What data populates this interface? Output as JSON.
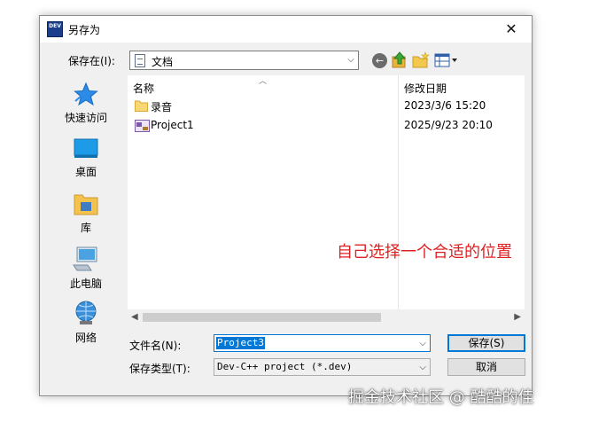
{
  "dialog": {
    "title": "另存为",
    "app_icon_text": "DEV",
    "close_glyph": "✕"
  },
  "location": {
    "label": "保存在(I):",
    "current_folder": "文档"
  },
  "places": [
    {
      "label": "快速访问",
      "icon": "star-icon"
    },
    {
      "label": "桌面",
      "icon": "desktop-icon"
    },
    {
      "label": "库",
      "icon": "library-icon"
    },
    {
      "label": "此电脑",
      "icon": "computer-icon"
    },
    {
      "label": "网络",
      "icon": "network-icon"
    }
  ],
  "file_list": {
    "columns": {
      "name": "名称",
      "modified": "修改日期"
    },
    "items": [
      {
        "name": "录音",
        "modified": "2023/3/6 15:20",
        "icon": "folder-icon"
      },
      {
        "name": "Project1",
        "modified": "2025/9/23 20:10",
        "icon": "dev-project-icon"
      }
    ]
  },
  "form": {
    "filename_label": "文件名(N):",
    "filename_value": "Project3",
    "filetype_label": "保存类型(T):",
    "filetype_value": "Dev-C++ project (*.dev)"
  },
  "buttons": {
    "save": "保存(S)",
    "cancel": "取消"
  },
  "annotation": "自己选择一个合适的位置",
  "watermark": "掘金技术社区 @ 酷酷的佳",
  "colors": {
    "accent": "#0078d7",
    "annotation": "#e02020"
  }
}
